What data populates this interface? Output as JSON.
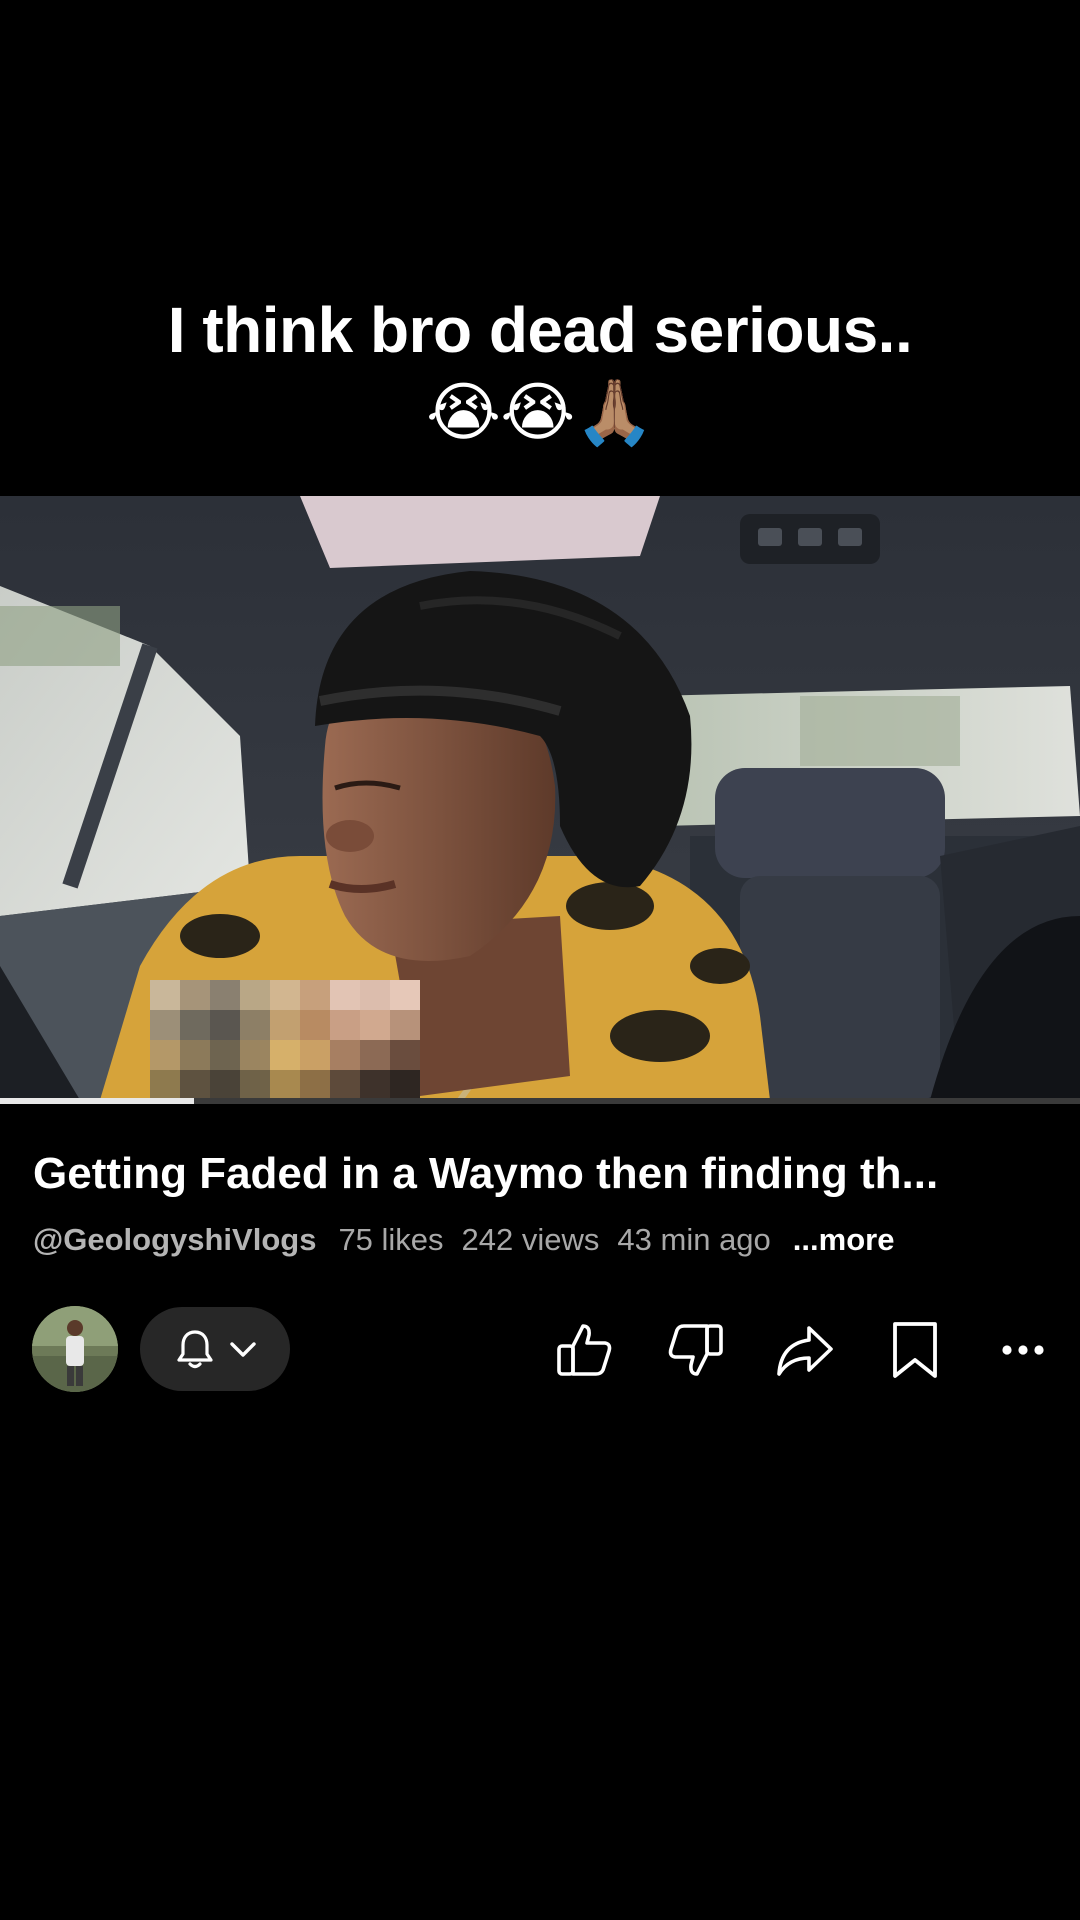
{
  "caption": {
    "text": "I think bro dead serious..",
    "emojis": "😭😭🙏🏽"
  },
  "video": {
    "progress_fraction": 0.18
  },
  "info": {
    "title": "Getting Faded in a Waymo then finding th...",
    "channel_handle": "@GeologyshiVlogs",
    "likes": "75 likes",
    "views": "242 views",
    "time_ago": "43 min ago",
    "more_label": "...more"
  },
  "actions": {
    "icons": [
      "bell-icon",
      "chevron-down-icon",
      "thumbs-up-icon",
      "thumbs-down-icon",
      "share-icon",
      "bookmark-icon",
      "more-icon"
    ]
  },
  "colors": {
    "background": "#000000",
    "pill": "#272727",
    "meta_text": "#a8a8a8"
  }
}
